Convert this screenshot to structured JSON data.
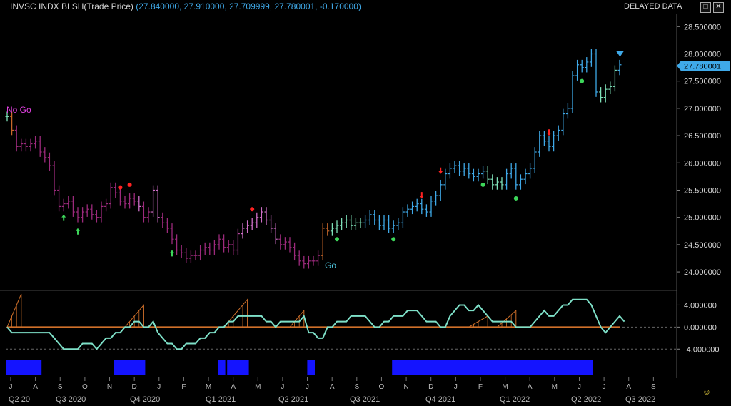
{
  "header": {
    "instrument": "INVSC INDX BLSH(Trade Price)",
    "values": "(27.840000, 27.910000, 27.709999, 27.780001, -0.170000)",
    "delayed": "DELAYED DATA"
  },
  "price_axis": {
    "ticks": [
      "28.500000",
      "28.000000",
      "27.500000",
      "27.000000",
      "26.500000",
      "26.000000",
      "25.500000",
      "25.000000",
      "24.500000",
      "24.000000"
    ],
    "tick_values": [
      28.5,
      28.0,
      27.5,
      27.0,
      26.5,
      26.0,
      25.5,
      25.0,
      24.5,
      24.0
    ],
    "last_price": "27.780001",
    "last_value": 27.78
  },
  "osc_axis": {
    "ticks": [
      "4.000000",
      "0.000000",
      "-4.000000"
    ],
    "tick_values": [
      4,
      0,
      -4
    ]
  },
  "labels": {
    "nogo": "No Go",
    "go": "Go"
  },
  "months": [
    "J",
    "A",
    "S",
    "O",
    "N",
    "D",
    "J",
    "F",
    "M",
    "A",
    "M",
    "J",
    "J",
    "A",
    "S",
    "O",
    "N",
    "D",
    "J",
    "F",
    "M",
    "A",
    "M",
    "J",
    "J",
    "A",
    "S"
  ],
  "quarters": [
    "Q2 20",
    "Q3 2020",
    "Q4 2020",
    "Q1 2021",
    "Q2 2021",
    "Q3 2021",
    "Q4 2021",
    "Q1 2022",
    "Q2 2022",
    "Q3 2022"
  ],
  "colors": {
    "nogo_strong": "#9c2a7c",
    "nogo_weak": "#d06fc8",
    "nogo_mid": "#b84aa0",
    "go_strong": "#3fa9e8",
    "go_weak": "#7ee0b8",
    "amber": "#c8682a",
    "osc_line": "#7ee0c8",
    "osc_zero": "#d0702a",
    "blue_bar": "#1414ff"
  },
  "chart_data": {
    "type": "bar",
    "price_ohlc_closes": [
      26.85,
      26.6,
      26.3,
      26.35,
      26.3,
      26.35,
      26.4,
      26.2,
      26.1,
      25.95,
      25.5,
      25.2,
      25.25,
      25.3,
      25.1,
      25.0,
      25.1,
      25.15,
      25.05,
      25.0,
      25.2,
      25.25,
      25.55,
      25.45,
      25.3,
      25.25,
      25.35,
      25.3,
      25.2,
      25.0,
      25.1,
      25.5,
      25.0,
      24.9,
      24.8,
      24.6,
      24.4,
      24.35,
      24.25,
      24.3,
      24.3,
      24.4,
      24.45,
      24.4,
      24.5,
      24.6,
      24.45,
      24.5,
      24.4,
      24.7,
      24.8,
      24.85,
      24.9,
      25.0,
      25.1,
      24.95,
      24.8,
      24.6,
      24.5,
      24.55,
      24.45,
      24.3,
      24.2,
      24.15,
      24.2,
      24.2,
      24.3,
      24.8,
      24.75,
      24.8,
      24.85,
      24.9,
      24.95,
      24.85,
      24.9,
      24.9,
      24.95,
      25.05,
      24.95,
      24.85,
      24.95,
      24.8,
      24.85,
      24.9,
      25.1,
      25.15,
      25.2,
      25.25,
      25.15,
      25.1,
      25.3,
      25.4,
      25.6,
      25.8,
      25.9,
      25.95,
      25.85,
      25.9,
      25.8,
      25.75,
      25.8,
      25.85,
      25.7,
      25.6,
      25.65,
      25.6,
      25.8,
      25.9,
      25.6,
      25.7,
      25.8,
      25.9,
      26.2,
      26.5,
      26.4,
      26.3,
      26.5,
      26.6,
      26.9,
      27.0,
      27.6,
      27.8,
      27.75,
      27.85,
      28.0,
      27.3,
      27.2,
      27.35,
      27.4,
      27.7,
      27.8
    ],
    "bar_colors": [
      "go_weak",
      "amber",
      "nogo_strong",
      "nogo_strong",
      "nogo_strong",
      "nogo_strong",
      "nogo_strong",
      "nogo_strong",
      "nogo_strong",
      "nogo_strong",
      "nogo_strong",
      "nogo_strong",
      "nogo_strong",
      "nogo_strong",
      "nogo_strong",
      "nogo_strong",
      "nogo_strong",
      "nogo_strong",
      "nogo_strong",
      "nogo_strong",
      "nogo_strong",
      "nogo_strong",
      "nogo_strong",
      "nogo_strong",
      "nogo_strong",
      "nogo_strong",
      "nogo_strong",
      "nogo_strong",
      "nogo_weak",
      "nogo_strong",
      "nogo_strong",
      "nogo_weak",
      "nogo_weak",
      "nogo_strong",
      "nogo_strong",
      "nogo_strong",
      "nogo_strong",
      "nogo_strong",
      "nogo_strong",
      "nogo_strong",
      "nogo_strong",
      "nogo_strong",
      "nogo_strong",
      "nogo_strong",
      "nogo_strong",
      "nogo_strong",
      "nogo_strong",
      "nogo_strong",
      "nogo_strong",
      "nogo_mid",
      "nogo_weak",
      "nogo_weak",
      "nogo_weak",
      "nogo_weak",
      "nogo_weak",
      "nogo_weak",
      "nogo_weak",
      "nogo_weak",
      "nogo_strong",
      "nogo_strong",
      "nogo_strong",
      "nogo_strong",
      "nogo_strong",
      "nogo_strong",
      "nogo_strong",
      "nogo_strong",
      "nogo_strong",
      "amber",
      "amber",
      "go_weak",
      "go_weak",
      "go_weak",
      "go_weak",
      "go_weak",
      "go_weak",
      "go_weak",
      "go_strong",
      "go_strong",
      "go_strong",
      "go_strong",
      "go_strong",
      "go_strong",
      "go_strong",
      "go_strong",
      "go_strong",
      "go_strong",
      "go_strong",
      "go_strong",
      "go_strong",
      "go_strong",
      "go_strong",
      "go_strong",
      "go_strong",
      "go_strong",
      "go_strong",
      "go_strong",
      "go_strong",
      "go_strong",
      "go_strong",
      "go_strong",
      "go_strong",
      "go_strong",
      "go_weak",
      "go_weak",
      "go_weak",
      "go_weak",
      "go_strong",
      "go_strong",
      "go_strong",
      "go_strong",
      "go_strong",
      "go_strong",
      "go_strong",
      "go_strong",
      "go_strong",
      "go_strong",
      "go_strong",
      "go_strong",
      "go_strong",
      "go_strong",
      "go_strong",
      "go_strong",
      "go_strong",
      "go_strong",
      "go_strong",
      "go_strong",
      "go_weak",
      "go_weak",
      "go_weak",
      "go_weak",
      "go_strong",
      "go_strong"
    ],
    "price_ylim": [
      23.7,
      28.7
    ],
    "osc_values": [
      0,
      -1,
      -1,
      -1,
      -1,
      -1,
      -1,
      -1,
      -1,
      -1,
      -2,
      -3,
      -4,
      -4,
      -4,
      -4,
      -3,
      -3,
      -3,
      -4,
      -3,
      -2,
      -2,
      -1,
      -1,
      0,
      0,
      1,
      1,
      0,
      0,
      1,
      -1,
      -2,
      -3,
      -3,
      -4,
      -4,
      -3,
      -3,
      -3,
      -2,
      -2,
      -1,
      -1,
      0,
      0,
      1,
      1,
      2,
      2,
      2,
      2,
      2,
      2,
      1,
      1,
      0,
      1,
      1,
      1,
      1,
      1,
      2,
      -1,
      -1,
      -2,
      -2,
      0,
      0,
      1,
      1,
      1,
      2,
      2,
      2,
      2,
      1,
      0,
      0,
      1,
      1,
      2,
      2,
      2,
      3,
      3,
      3,
      2,
      1,
      1,
      1,
      0,
      0,
      2,
      3,
      4,
      4,
      3,
      3,
      4,
      3,
      2,
      1,
      1,
      1,
      1,
      1,
      0,
      0,
      0,
      0,
      1,
      2,
      3,
      2,
      2,
      3,
      4,
      4,
      5,
      5,
      5,
      5,
      4,
      2,
      0,
      -1,
      0,
      1,
      2,
      1
    ],
    "osc_ylim": [
      -5,
      6
    ],
    "nogo_markers": [
      {
        "i": 24,
        "type": "dot",
        "color": "#ff2222"
      },
      {
        "i": 26,
        "type": "dot",
        "color": "#ff2222"
      },
      {
        "i": 52,
        "type": "dot",
        "color": "#ff2222"
      },
      {
        "i": 88,
        "type": "arrow_down",
        "color": "#ff2222"
      },
      {
        "i": 92,
        "type": "arrow_down",
        "color": "#ff2222"
      },
      {
        "i": 115,
        "type": "arrow_down",
        "color": "#ff2222"
      }
    ],
    "go_markers": [
      {
        "i": 12,
        "type": "arrow_up",
        "color": "#3dd65a"
      },
      {
        "i": 15,
        "type": "arrow_up",
        "color": "#3dd65a"
      },
      {
        "i": 35,
        "type": "arrow_up",
        "color": "#3dd65a"
      },
      {
        "i": 70,
        "type": "dot",
        "color": "#3dd65a"
      },
      {
        "i": 82,
        "type": "dot",
        "color": "#3dd65a"
      },
      {
        "i": 101,
        "type": "dot",
        "color": "#3dd65a"
      },
      {
        "i": 108,
        "type": "dot",
        "color": "#3dd65a"
      },
      {
        "i": 122,
        "type": "dot",
        "color": "#3dd65a"
      }
    ],
    "blue_segments": [
      [
        0,
        7
      ],
      [
        23,
        29
      ],
      [
        45,
        46
      ],
      [
        47,
        51
      ],
      [
        64,
        65
      ],
      [
        82,
        124
      ]
    ]
  }
}
